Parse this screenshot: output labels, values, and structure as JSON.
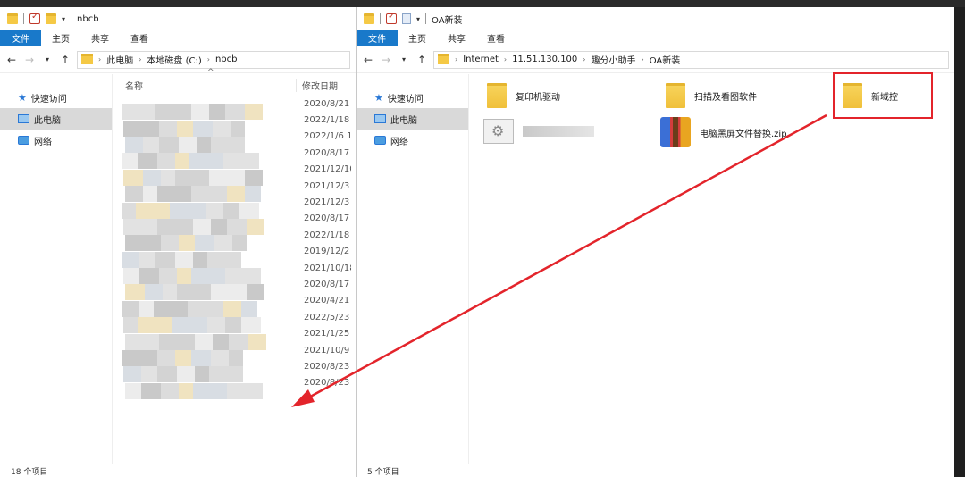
{
  "left": {
    "title": "nbcb",
    "ribbon": [
      "文件",
      "主页",
      "共享",
      "查看"
    ],
    "path": [
      "此电脑",
      "本地磁盘 (C:)",
      "nbcb"
    ],
    "nav": [
      "快速访问",
      "此电脑",
      "网络"
    ],
    "columns": {
      "name": "名称",
      "date": "修改日期"
    },
    "dates": [
      "2020/8/21 1",
      "2022/1/18 1",
      "2022/1/6 15",
      "2020/8/17 1",
      "2021/12/10",
      "2021/12/3 1",
      "2021/12/3 1",
      "2020/8/17 1",
      "2022/1/18 1",
      "2019/12/2 1",
      "2021/10/18",
      "2020/8/17 1",
      "2020/4/21 1",
      "2022/5/23 1",
      "2021/1/25 1",
      "2021/10/9 8",
      "2020/8/23 9",
      "2020/8/23 9"
    ],
    "status": "18 个项目"
  },
  "right": {
    "title": "OA新装",
    "ribbon": [
      "文件",
      "主页",
      "共享",
      "查看"
    ],
    "path": [
      "Internet",
      "11.51.130.100",
      "趣分小助手",
      "OA新装"
    ],
    "nav": [
      "快速访问",
      "此电脑",
      "网络"
    ],
    "items": [
      "复印机驱动",
      "扫描及看图软件",
      "新域控",
      "电脑黑屏文件替换.zip"
    ],
    "status": "5 个项目"
  },
  "colors": {
    "accent": "#1979ca",
    "annotation": "#e3242b"
  }
}
